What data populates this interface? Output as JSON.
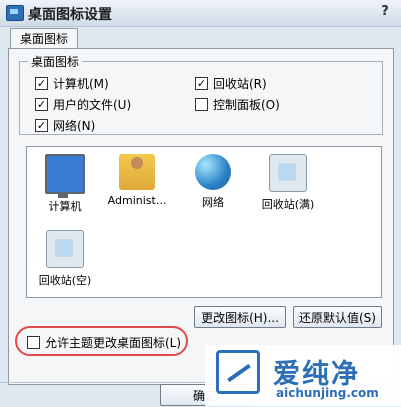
{
  "window": {
    "title": "桌面图标设置",
    "help": "?"
  },
  "tabs": [
    {
      "label": "桌面图标"
    }
  ],
  "desktop_icons_group": {
    "title": "桌面图标",
    "checkboxes": [
      {
        "label": "计算机(M)",
        "checked": true
      },
      {
        "label": "回收站(R)",
        "checked": true
      },
      {
        "label": "用户的文件(U)",
        "checked": true
      },
      {
        "label": "控制面板(O)",
        "checked": false
      },
      {
        "label": "网络(N)",
        "checked": true
      }
    ]
  },
  "icon_list": [
    {
      "label": "计算机",
      "icon": "computer-icon"
    },
    {
      "label": "Administ...",
      "icon": "user-folder-icon"
    },
    {
      "label": "网络",
      "icon": "network-icon"
    },
    {
      "label": "回收站(满)",
      "icon": "recycle-bin-full-icon"
    },
    {
      "label": "回收站(空)",
      "icon": "recycle-bin-empty-icon"
    }
  ],
  "buttons": {
    "change_icon": "更改图标(H)...",
    "restore_default": "还原默认值(S)"
  },
  "allow_theme": {
    "label": "允许主题更改桌面图标(L)",
    "checked": false
  },
  "footer": {
    "ok_label": "确定"
  },
  "watermark": {
    "brand_cn": "爱纯净",
    "url": "aichunjing.com"
  }
}
